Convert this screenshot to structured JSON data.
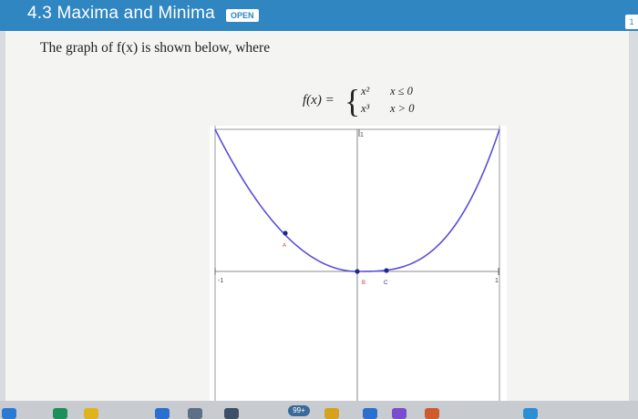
{
  "header": {
    "title": "4.3 Maxima and Minima",
    "badge": "OPEN",
    "corner_tab": "1"
  },
  "problem": {
    "intro": "The graph of f(x) is shown below, where",
    "formula": {
      "lhs": "f(x) =",
      "case1_expr": "x²",
      "case1_cond": "x ≤ 0",
      "case2_expr": "x³",
      "case2_cond": "x > 0"
    }
  },
  "graph": {
    "tick_left": "-1",
    "tick_right": "1",
    "tick_top": "1",
    "point_a": "A",
    "point_b": "B",
    "point_c": "C",
    "curve_color": "#5a4ed8",
    "point_color": "#1e2a8a"
  },
  "taskbar": {
    "badge": "99+"
  }
}
